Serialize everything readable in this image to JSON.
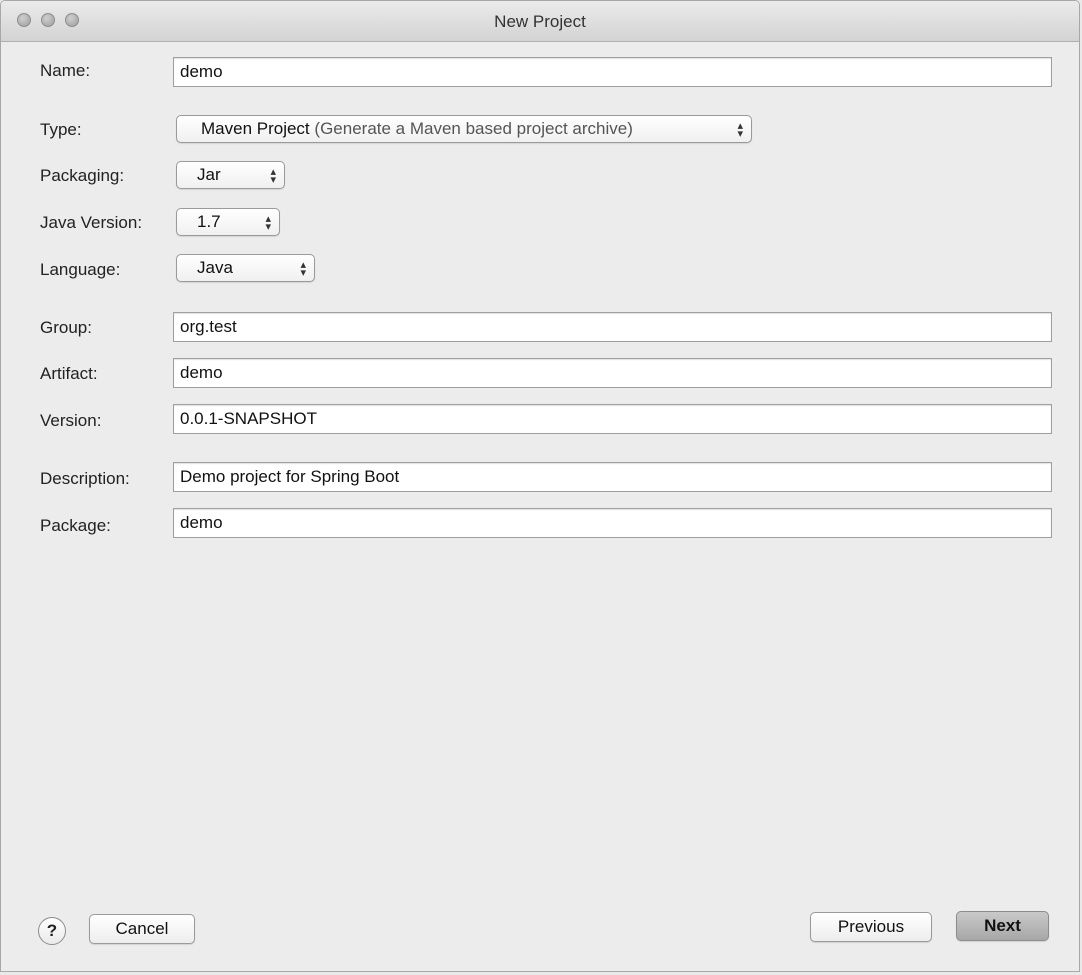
{
  "window": {
    "title": "New Project"
  },
  "form": {
    "name": {
      "label": "Name:",
      "value": "demo"
    },
    "type": {
      "label": "Type:",
      "value": "Maven Project",
      "hint": "(Generate a Maven based project archive)"
    },
    "packaging": {
      "label": "Packaging:",
      "value": "Jar"
    },
    "java_version": {
      "label": "Java Version:",
      "value": "1.7"
    },
    "language": {
      "label": "Language:",
      "value": "Java"
    },
    "group": {
      "label": "Group:",
      "value": "org.test"
    },
    "artifact": {
      "label": "Artifact:",
      "value": "demo"
    },
    "version": {
      "label": "Version:",
      "value": "0.0.1-SNAPSHOT"
    },
    "description": {
      "label": "Description:",
      "value": "Demo project for Spring Boot"
    },
    "package": {
      "label": "Package:",
      "value": "demo"
    }
  },
  "footer": {
    "help_label": "?",
    "cancel_label": "Cancel",
    "previous_label": "Previous",
    "next_label": "Next"
  }
}
